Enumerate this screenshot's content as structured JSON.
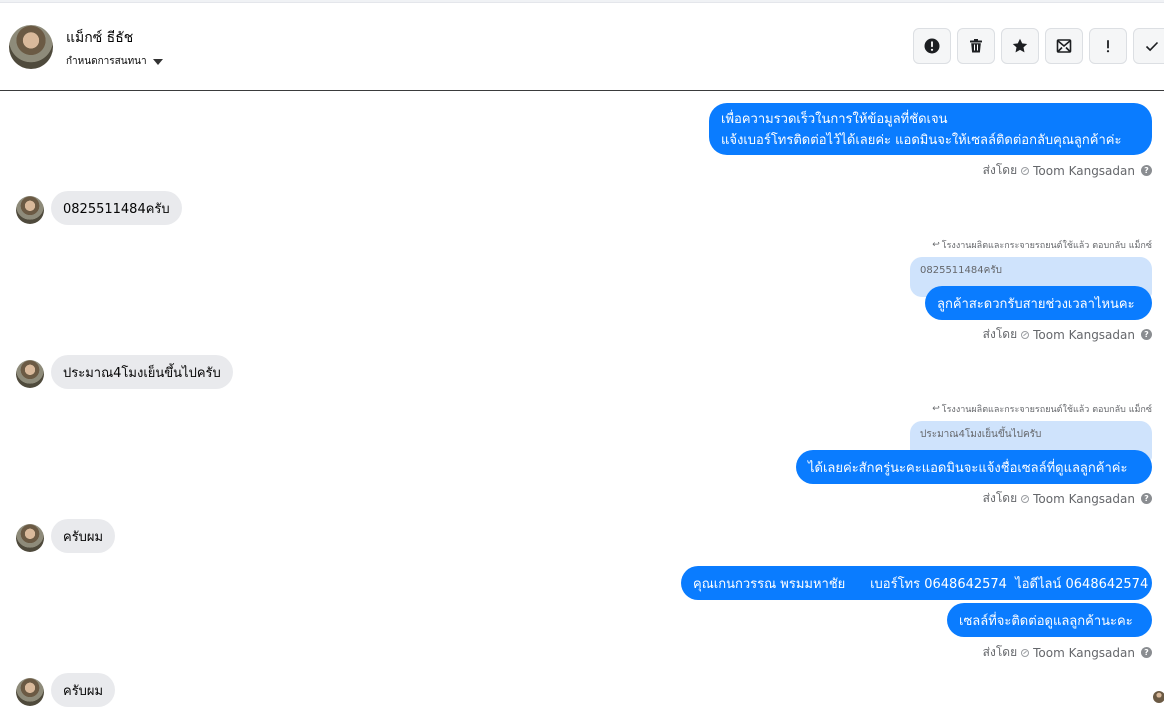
{
  "header": {
    "contact_name": "แม็กซ์ ธีธัช",
    "subtitle": "กำหนดการสนทนา",
    "toolbar": [
      {
        "name": "spam-button",
        "icon": "alert-circle-icon"
      },
      {
        "name": "delete-button",
        "icon": "trash-icon"
      },
      {
        "name": "star-button",
        "icon": "star-icon"
      },
      {
        "name": "mark-unread-button",
        "icon": "envelope-icon"
      },
      {
        "name": "follow-up-button",
        "icon": "exclamation-icon"
      },
      {
        "name": "done-button",
        "icon": "check-icon"
      }
    ]
  },
  "messages": {
    "m1": {
      "line1": "เพื่อความรวดเร็วในการให้ข้อมูลที่ชัดเจน",
      "line2": "แจ้งเบอร์โทรติดต่อไว้ได้เลยค่ะ แอดมินจะให้เซลล์ติดต่อกลับคุณลูกค้าค่ะ"
    },
    "m2": "0825511484ครับ",
    "m3_reply_meta": "โรงงานผลิตและกระจายรถยนต์ใช้แล้ว ตอบกลับ แม็กซ์",
    "m3_quote": "0825511484ครับ",
    "m3": "ลูกค้าสะดวกรับสายช่วงเวลาไหนคะ",
    "m4": "ประมาณ4โมงเย็นขึ้นไปครับ",
    "m5_reply_meta": "โรงงานผลิตและกระจายรถยนต์ใช้แล้ว ตอบกลับ แม็กซ์",
    "m5_quote": "ประมาณ4โมงเย็นขึ้นไปครับ",
    "m5": "ได้เลยค่ะสักครู่นะคะแอดมินจะแจ้งชื่อเซลล์ที่ดูแลลูกค้าค่ะ",
    "m6": "ครับผม",
    "m7": "คุณเกนกวรรณ พรมมหาชัย      เบอร์โทร 0648642574  ไอดีไลน์ 0648642574",
    "m8": "เซลล์ที่จะติดต่อดูแลลูกค้านะคะ",
    "m9": "ครับผม"
  },
  "sent_by": {
    "prefix": "ส่งโดย",
    "agent": "Toom Kangsadan"
  },
  "colors": {
    "outgoing_bubble": "#0a7cff",
    "incoming_bubble": "#e9eaed",
    "quote_bubble": "#cfe3fc"
  }
}
